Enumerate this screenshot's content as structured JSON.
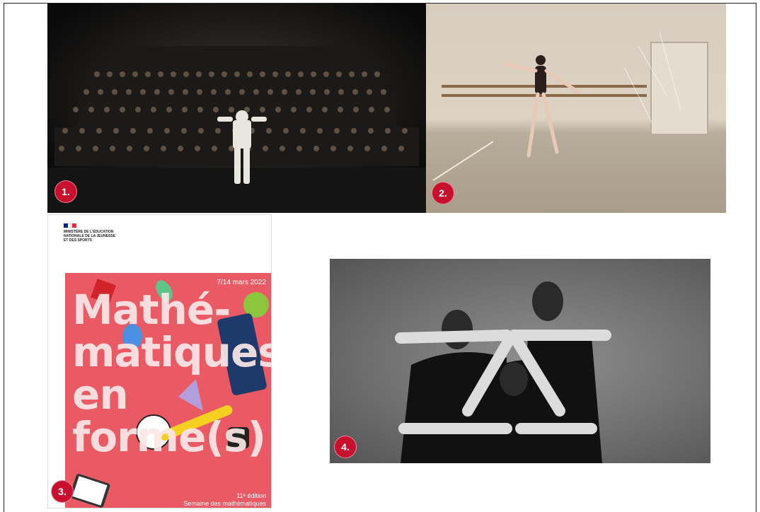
{
  "badges": {
    "b1": "1.",
    "b2": "2.",
    "b3": "3.",
    "b4": "4."
  },
  "poster": {
    "ministry": "MINISTÈRE DE L'ÉDUCATION NATIONALE DE LA JEUNESSE ET DES SPORTS",
    "date": "7/14 mars 2022",
    "title_line1": "Mathé-",
    "title_line2": "matiques",
    "title_line3": "en",
    "title_line4": "forme(s)",
    "edition": "11ᵉ édition",
    "event": "Semaine des mathématiques"
  },
  "colors": {
    "badge": "#c8102e",
    "poster_pink": "#ea5a64",
    "flag_blue": "#002395",
    "flag_white": "#ffffff",
    "flag_red": "#ed2939"
  },
  "icons": {
    "photo1": "stage-dance-photo",
    "photo2": "ballet-studio-photo",
    "photo3": "math-poster",
    "photo4": "trio-arms-photo"
  }
}
